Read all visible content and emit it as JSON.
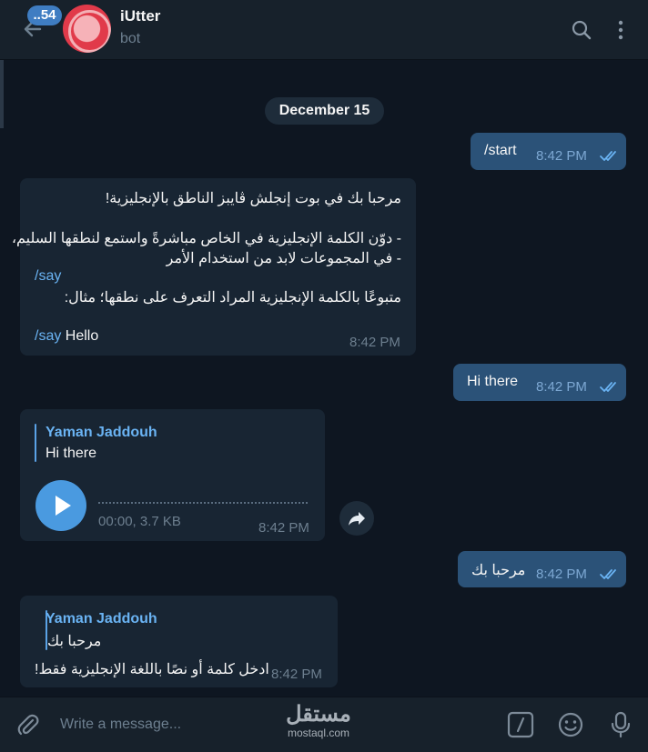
{
  "header": {
    "unread_badge": "..54",
    "title": "iUtter",
    "subtitle": "bot",
    "back_icon": "arrow-left-icon",
    "search_icon": "search-icon",
    "menu_icon": "more-vertical-icon"
  },
  "chat": {
    "date": "December 15",
    "messages": [
      {
        "type": "outgoing",
        "text": "/start",
        "time": "8:42 PM",
        "status": "read"
      },
      {
        "type": "incoming",
        "lines": [
          "مرحبا بك في بوت إنجلش ڤايبز الناطق بالإنجليزية!",
          "- دوّن الكلمة الإنجليزية في الخاص مباشرةً واستمع لنطقها السليم،",
          "- في المجموعات لابد من استخدام الأمر",
          "/say",
          "متبوعًا بالكلمة الإنجليزية المراد التعرف على نطقها؛ مثال:",
          "/say",
          " Hello"
        ],
        "time": "8:42 PM"
      },
      {
        "type": "outgoing",
        "text": "Hi there",
        "time": "8:42 PM",
        "status": "read"
      },
      {
        "type": "incoming-voice",
        "reply_name": "Yaman Jaddouh",
        "reply_text": "Hi there",
        "duration": "00:00, 3.7 KB",
        "time": "8:42 PM",
        "play_icon": "play-icon",
        "forward_icon": "forward-icon"
      },
      {
        "type": "outgoing",
        "text": "مرحبا بك",
        "time": "8:42 PM",
        "status": "read"
      },
      {
        "type": "incoming",
        "reply_name": "Yaman Jaddouh",
        "reply_text": "مرحبا بك",
        "text": "ادخل كلمة أو نصًا باللغة الإنجليزية فقط!",
        "time": "8:42 PM"
      }
    ]
  },
  "input": {
    "placeholder": "Write a message...",
    "attach_icon": "paperclip-icon",
    "commands_icon": "slash-command-icon",
    "emoji_icon": "emoji-icon",
    "mic_icon": "microphone-icon"
  },
  "watermark": {
    "arabic": "مستقل",
    "latin": "mostaql.com"
  },
  "colors": {
    "background": "#0e1621",
    "header": "#17212b",
    "outgoing_bubble": "#2b5278",
    "incoming_bubble": "#182533",
    "accent": "#6ab3f3"
  }
}
